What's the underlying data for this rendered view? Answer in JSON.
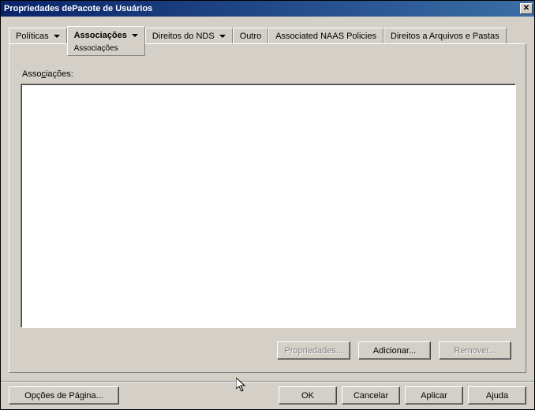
{
  "titlebar": {
    "title": "Propriedades dePacote de Usuários"
  },
  "tabs": {
    "politicas": "Políticas",
    "associacoes": "Associações",
    "associacoes_sub": "Associações",
    "direitos_nds": "Direitos do NDS",
    "outro": "Outro",
    "naas": "Associated NAAS Policies",
    "arquivos": "Direitos a Arquivos e Pastas"
  },
  "panel": {
    "label_prefix": "Asso",
    "label_underline": "c",
    "label_suffix": "iações:"
  },
  "buttons": {
    "propriedades": "Propriedades...",
    "adicionar": "Adicionar...",
    "remover": "Remover..."
  },
  "bottom": {
    "opcoes": "Opções de Página...",
    "ok": "OK",
    "cancelar": "Cancelar",
    "aplicar": "Aplicar",
    "ajuda": "Ajuda"
  }
}
